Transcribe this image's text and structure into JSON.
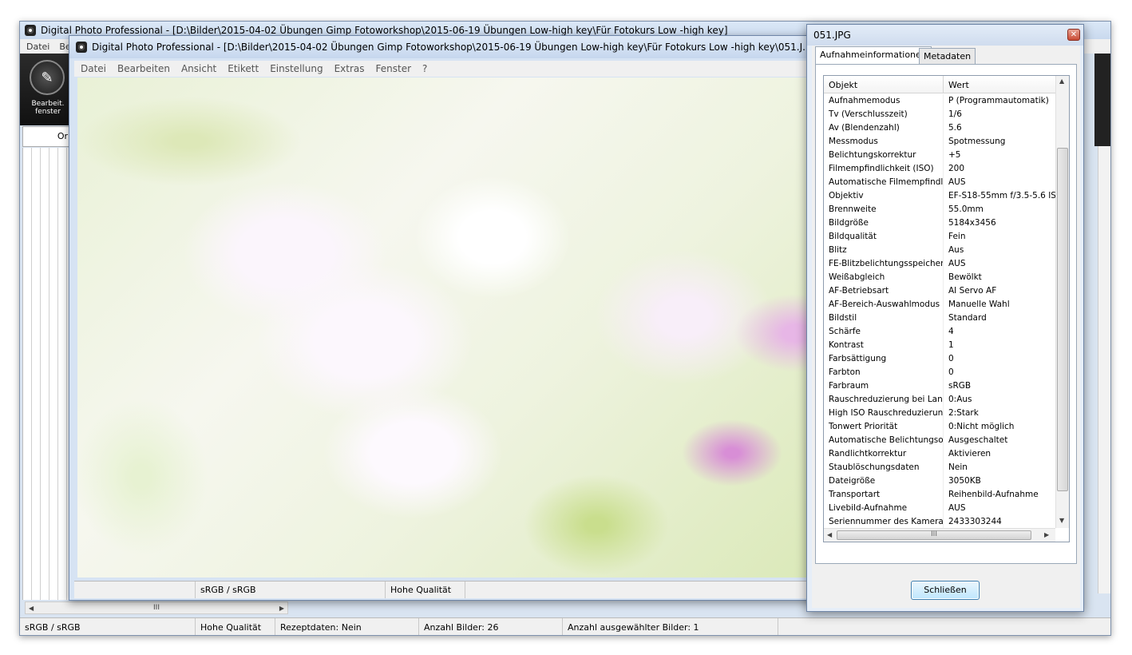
{
  "main_window": {
    "title": "Digital Photo Professional - [D:\\Bilder\\2015-04-02 Übungen  Gimp Fotoworkshop\\2015-06-19 Übungen Low-high key\\Für Fotokurs Low -high key]",
    "menu_partial": [
      "Datei",
      "Be"
    ],
    "toolbar": {
      "edit_label": "Bearbeit. fenster"
    },
    "left_tab_label": "Or",
    "status": {
      "colorspace": "sRGB / sRGB",
      "quality": "Hohe Qualität",
      "recipe": "Rezeptdaten: Nein",
      "count": "Anzahl Bilder: 26",
      "selected": "Anzahl ausgewählter Bilder: 1"
    }
  },
  "edit_window": {
    "title": "Digital Photo Professional - [D:\\Bilder\\2015-04-02 Übungen  Gimp Fotoworkshop\\2015-06-19 Übungen Low-high key\\Für Fotokurs Low -high key\\051.J...",
    "menu": [
      "Datei",
      "Bearbeiten",
      "Ansicht",
      "Etikett",
      "Einstellung",
      "Extras",
      "Fenster",
      "?"
    ],
    "status": {
      "colorspace": "sRGB / sRGB",
      "quality": "Hohe Qualität"
    }
  },
  "info_dialog": {
    "title": "051.JPG",
    "tabs": [
      "Aufnahmeinformationen",
      "Metadaten"
    ],
    "columns": [
      "Objekt",
      "Wert"
    ],
    "rows": [
      [
        "Aufnahmemodus",
        "P (Programmautomatik)"
      ],
      [
        "Tv (Verschlusszeit)",
        "1/6"
      ],
      [
        "Av (Blendenzahl)",
        "5.6"
      ],
      [
        "Messmodus",
        "Spotmessung"
      ],
      [
        "Belichtungskorrektur",
        "+5"
      ],
      [
        "Filmempfindlichkeit (ISO)",
        "200"
      ],
      [
        "Automatische Filmempfindli...",
        "AUS"
      ],
      [
        "Objektiv",
        "EF-S18-55mm f/3.5-5.6 IS I"
      ],
      [
        "Brennweite",
        "55.0mm"
      ],
      [
        "Bildgröße",
        "5184x3456"
      ],
      [
        "Bildqualität",
        "Fein"
      ],
      [
        "Blitz",
        "Aus"
      ],
      [
        "FE-Blitzbelichtungsspeicher...",
        "AUS"
      ],
      [
        "Weißabgleich",
        "Bewölkt"
      ],
      [
        "AF-Betriebsart",
        "AI Servo AF"
      ],
      [
        "AF-Bereich-Auswahlmodus",
        "Manuelle  Wahl"
      ],
      [
        "Bildstil",
        "Standard"
      ],
      [
        "Schärfe",
        "4"
      ],
      [
        "Kontrast",
        "1"
      ],
      [
        "Farbsättigung",
        "0"
      ],
      [
        "Farbton",
        "0"
      ],
      [
        "Farbraum",
        "sRGB"
      ],
      [
        "Rauschreduzierung bei Lan...",
        "0:Aus"
      ],
      [
        "High ISO Rauschreduzierung",
        "2:Stark"
      ],
      [
        "Tonwert Priorität",
        "0:Nicht möglich"
      ],
      [
        "Automatische Belichtungso...",
        "Ausgeschaltet"
      ],
      [
        "Randlichtkorrektur",
        "Aktivieren"
      ],
      [
        "Staublöschungsdaten",
        "Nein"
      ],
      [
        "Dateigröße",
        "3050KB"
      ],
      [
        "Transportart",
        "Reihenbild-Aufnahme"
      ],
      [
        "Livebild-Aufnahme",
        "AUS"
      ],
      [
        "Seriennummer des Kamera...",
        "2433303244"
      ]
    ],
    "close_label": "Schließen",
    "scroll_grip": "III"
  }
}
